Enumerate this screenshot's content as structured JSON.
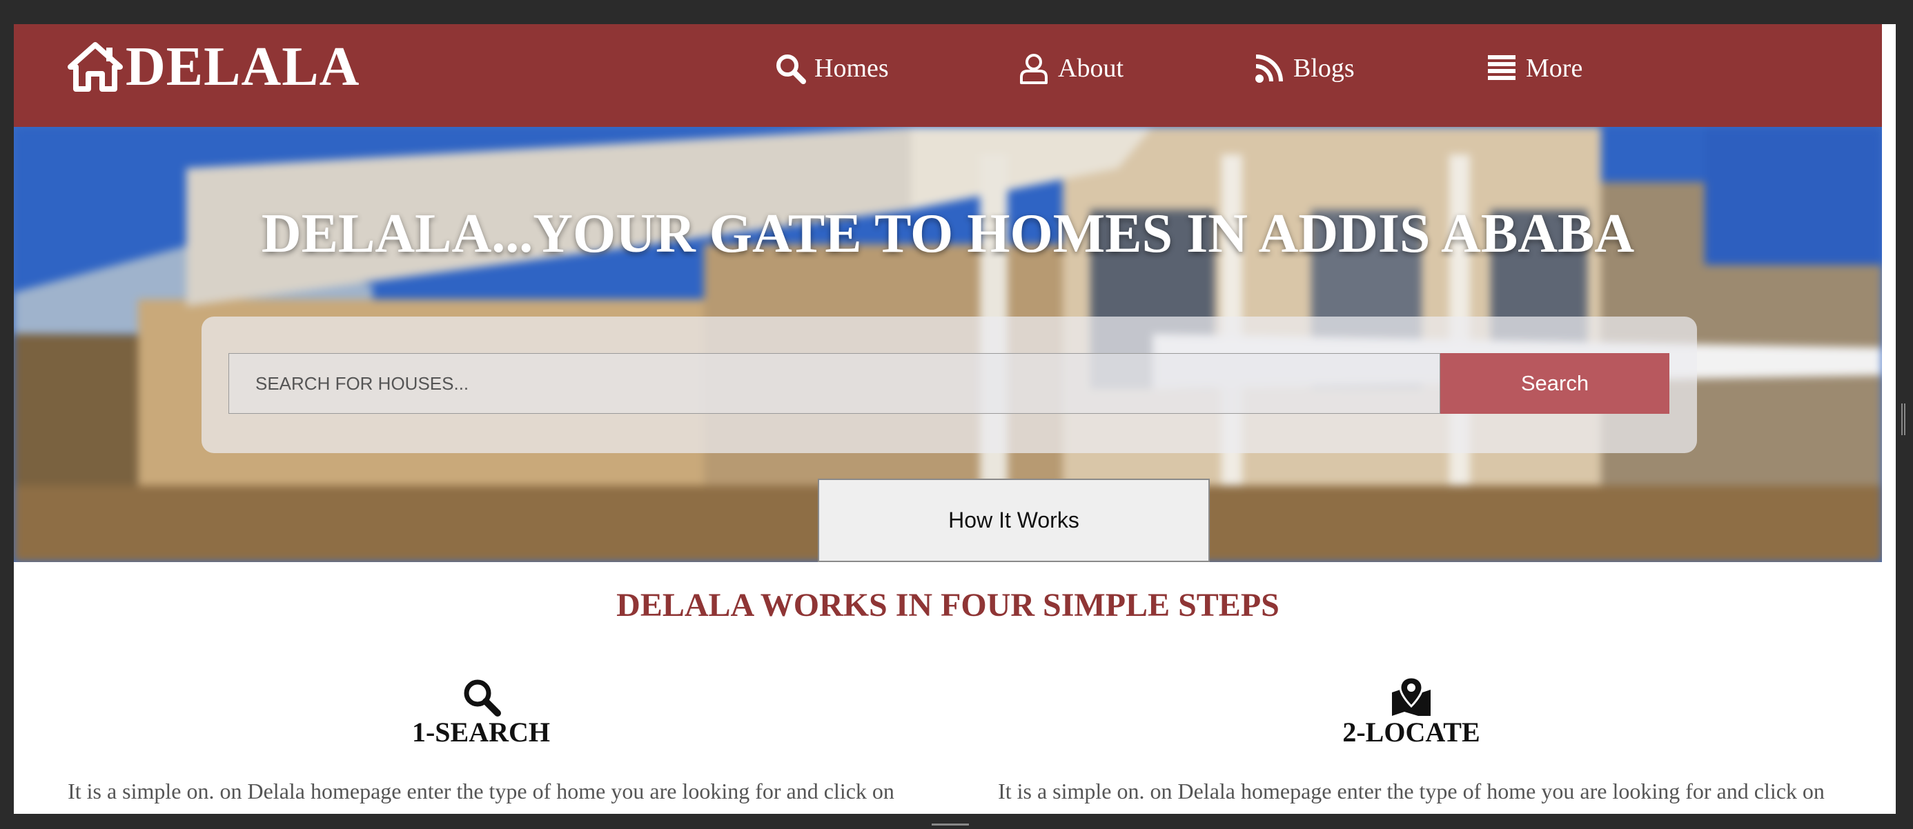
{
  "brand": {
    "name": "DELALA",
    "icon": "home-icon"
  },
  "nav": {
    "items": [
      {
        "label": "Homes",
        "icon": "search-icon"
      },
      {
        "label": "About",
        "icon": "user-icon"
      },
      {
        "label": "Blogs",
        "icon": "rss-icon"
      },
      {
        "label": "More",
        "icon": "menu-icon"
      }
    ]
  },
  "hero": {
    "title": "DELALA...YOUR GATE TO HOMES IN ADDIS ABABA",
    "search_placeholder": "SEARCH FOR HOUSES...",
    "search_button": "Search",
    "how_button": "How It Works"
  },
  "steps": {
    "heading": "DELALA WORKS IN FOUR SIMPLE STEPS",
    "items": [
      {
        "title": "1-SEARCH",
        "icon": "search-icon",
        "text": "It is a simple on. on Delala homepage enter the type of home you are looking for and click on"
      },
      {
        "title": "2-LOCATE",
        "icon": "map-marker-icon",
        "text": "It is a simple on. on Delala homepage enter the type of home you are looking for and click on"
      }
    ]
  },
  "colors": {
    "brand": "#8f3535",
    "search_button": "#b8585e"
  }
}
